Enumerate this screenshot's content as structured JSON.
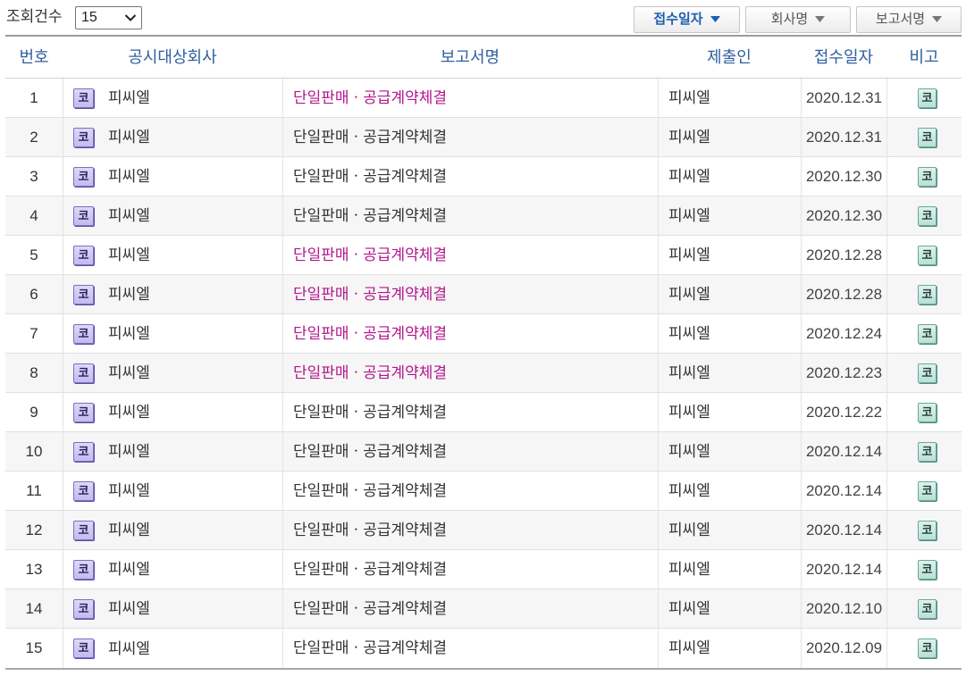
{
  "toolbar": {
    "count_label": "조회건수",
    "count_select": {
      "value": "15",
      "icon": "chevron-down-icon"
    },
    "sort_buttons": [
      {
        "label": "접수일자",
        "active": true,
        "icon": "caret-down-icon"
      },
      {
        "label": "회사명",
        "active": false,
        "icon": "caret-down-icon"
      },
      {
        "label": "보고서명",
        "active": false,
        "icon": "caret-down-icon"
      }
    ]
  },
  "table": {
    "headers": {
      "no": "번호",
      "company": "공시대상회사",
      "report": "보고서명",
      "submitter": "제출인",
      "date": "접수일자",
      "remark": "비고"
    },
    "rows": [
      {
        "no": "1",
        "market_badge": "코",
        "company": "피씨엘",
        "report": "단일판매ㆍ공급계약체결",
        "report_highlighted": true,
        "submitter": "피씨엘",
        "date": "2020.12.31",
        "remark_badge": "코"
      },
      {
        "no": "2",
        "market_badge": "코",
        "company": "피씨엘",
        "report": "단일판매ㆍ공급계약체결",
        "report_highlighted": false,
        "submitter": "피씨엘",
        "date": "2020.12.31",
        "remark_badge": "코"
      },
      {
        "no": "3",
        "market_badge": "코",
        "company": "피씨엘",
        "report": "단일판매ㆍ공급계약체결",
        "report_highlighted": false,
        "submitter": "피씨엘",
        "date": "2020.12.30",
        "remark_badge": "코"
      },
      {
        "no": "4",
        "market_badge": "코",
        "company": "피씨엘",
        "report": "단일판매ㆍ공급계약체결",
        "report_highlighted": false,
        "submitter": "피씨엘",
        "date": "2020.12.30",
        "remark_badge": "코"
      },
      {
        "no": "5",
        "market_badge": "코",
        "company": "피씨엘",
        "report": "단일판매ㆍ공급계약체결",
        "report_highlighted": true,
        "submitter": "피씨엘",
        "date": "2020.12.28",
        "remark_badge": "코"
      },
      {
        "no": "6",
        "market_badge": "코",
        "company": "피씨엘",
        "report": "단일판매ㆍ공급계약체결",
        "report_highlighted": true,
        "submitter": "피씨엘",
        "date": "2020.12.28",
        "remark_badge": "코"
      },
      {
        "no": "7",
        "market_badge": "코",
        "company": "피씨엘",
        "report": "단일판매ㆍ공급계약체결",
        "report_highlighted": true,
        "submitter": "피씨엘",
        "date": "2020.12.24",
        "remark_badge": "코"
      },
      {
        "no": "8",
        "market_badge": "코",
        "company": "피씨엘",
        "report": "단일판매ㆍ공급계약체결",
        "report_highlighted": true,
        "submitter": "피씨엘",
        "date": "2020.12.23",
        "remark_badge": "코"
      },
      {
        "no": "9",
        "market_badge": "코",
        "company": "피씨엘",
        "report": "단일판매ㆍ공급계약체결",
        "report_highlighted": false,
        "submitter": "피씨엘",
        "date": "2020.12.22",
        "remark_badge": "코"
      },
      {
        "no": "10",
        "market_badge": "코",
        "company": "피씨엘",
        "report": "단일판매ㆍ공급계약체결",
        "report_highlighted": false,
        "submitter": "피씨엘",
        "date": "2020.12.14",
        "remark_badge": "코"
      },
      {
        "no": "11",
        "market_badge": "코",
        "company": "피씨엘",
        "report": "단일판매ㆍ공급계약체결",
        "report_highlighted": false,
        "submitter": "피씨엘",
        "date": "2020.12.14",
        "remark_badge": "코"
      },
      {
        "no": "12",
        "market_badge": "코",
        "company": "피씨엘",
        "report": "단일판매ㆍ공급계약체결",
        "report_highlighted": false,
        "submitter": "피씨엘",
        "date": "2020.12.14",
        "remark_badge": "코"
      },
      {
        "no": "13",
        "market_badge": "코",
        "company": "피씨엘",
        "report": "단일판매ㆍ공급계약체결",
        "report_highlighted": false,
        "submitter": "피씨엘",
        "date": "2020.12.14",
        "remark_badge": "코"
      },
      {
        "no": "14",
        "market_badge": "코",
        "company": "피씨엘",
        "report": "단일판매ㆍ공급계약체결",
        "report_highlighted": false,
        "submitter": "피씨엘",
        "date": "2020.12.10",
        "remark_badge": "코"
      },
      {
        "no": "15",
        "market_badge": "코",
        "company": "피씨엘",
        "report": "단일판매ㆍ공급계약체결",
        "report_highlighted": false,
        "submitter": "피씨엘",
        "date": "2020.12.09",
        "remark_badge": "코"
      }
    ]
  },
  "colors": {
    "header_text": "#2f5f9f",
    "active_sort": "#1c5fb0",
    "highlight_report": "#b3168b",
    "alt_row_bg": "#f6f6f6",
    "market_badge_bg": "#c3bbee",
    "remark_badge_bg": "#b9e0d5"
  }
}
